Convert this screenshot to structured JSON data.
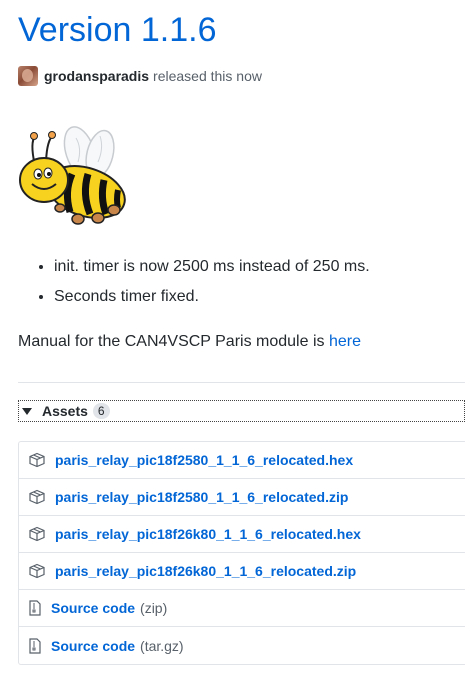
{
  "release": {
    "title": "Version 1.1.6",
    "author": "grodansparadis",
    "released_text": "released this now"
  },
  "notes": [
    "init. timer is now 2500 ms instead of 250 ms.",
    "Seconds timer fixed."
  ],
  "manual": {
    "text": "Manual for the CAN4VSCP Paris module is ",
    "link_text": "here"
  },
  "assets": {
    "label": "Assets",
    "count": "6",
    "files": [
      {
        "name": "paris_relay_pic18f2580_1_1_6_relocated.hex",
        "icon": "package-icon"
      },
      {
        "name": "paris_relay_pic18f2580_1_1_6_relocated.zip",
        "icon": "package-icon"
      },
      {
        "name": "paris_relay_pic18f26k80_1_1_6_relocated.hex",
        "icon": "package-icon"
      },
      {
        "name": "paris_relay_pic18f26k80_1_1_6_relocated.zip",
        "icon": "package-icon"
      }
    ],
    "source": [
      {
        "name": "Source code",
        "ext": "(zip)",
        "icon": "file-zip-icon"
      },
      {
        "name": "Source code",
        "ext": "(tar.gz)",
        "icon": "file-zip-icon"
      }
    ]
  },
  "colors": {
    "link": "#0366d6",
    "text": "#24292e",
    "muted": "#586069",
    "border": "#e1e4e8"
  }
}
